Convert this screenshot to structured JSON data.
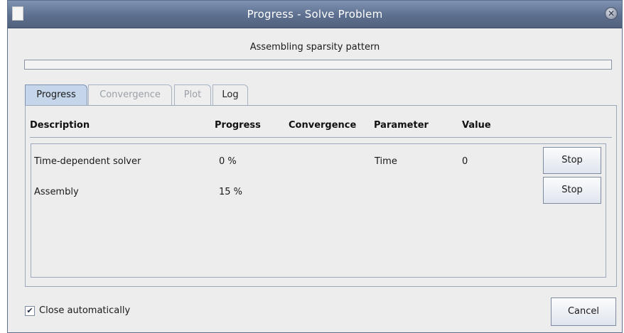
{
  "window": {
    "title": "Progress - Solve Problem",
    "status_text": "Assembling sparsity pattern",
    "overall_progress": 0
  },
  "tabs": [
    {
      "label": "Progress",
      "state": "active"
    },
    {
      "label": "Convergence",
      "state": "disabled"
    },
    {
      "label": "Plot",
      "state": "disabled"
    },
    {
      "label": "Log",
      "state": "enabled"
    }
  ],
  "table": {
    "headers": [
      "Description",
      "Progress",
      "Convergence",
      "Parameter",
      "Value"
    ],
    "rows": [
      {
        "description": "Time-dependent solver",
        "progress": "0 %",
        "convergence": "",
        "parameter": "Time",
        "value": "0",
        "button": "Stop"
      },
      {
        "description": "Assembly",
        "progress": "15 %",
        "convergence": "",
        "parameter": "",
        "value": "",
        "button": "Stop"
      }
    ]
  },
  "footer": {
    "close_automatically_label": "Close automatically",
    "close_automatically_checked": true,
    "check_glyph": "✔",
    "cancel_label": "Cancel"
  },
  "icons": {
    "app_icon": "document-icon",
    "close_icon": "close-icon",
    "close_glyph": "✕"
  },
  "colors": {
    "titlebar": "#5d6f8f",
    "active_tab": "#c5d5ea",
    "progress_fill": "#9fb6d8"
  }
}
